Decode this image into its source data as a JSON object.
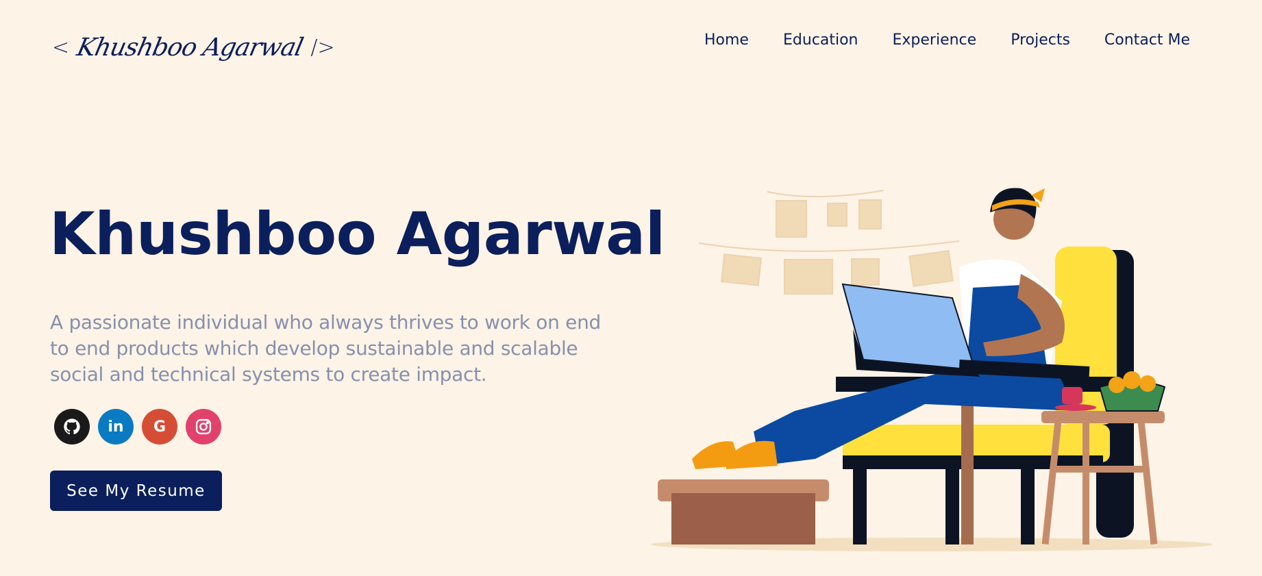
{
  "logo": {
    "open": "<",
    "signature": "Khushboo Agarwal",
    "close": "/>"
  },
  "nav": {
    "items": [
      "Home",
      "Education",
      "Experience",
      "Projects",
      "Contact Me"
    ]
  },
  "hero": {
    "title": "Khushboo Agarwal",
    "description": "A passionate individual who always thrives to work on end to end products which develop sustainable and scalable social and technical systems to create impact.",
    "resume_button": "See My Resume"
  },
  "socials": [
    {
      "icon": "github-icon",
      "color": "#1a1a1a"
    },
    {
      "icon": "linkedin-icon",
      "color": "#0a7bc2",
      "glyph": "in"
    },
    {
      "icon": "google-icon",
      "color": "#d64d35",
      "glyph": "G"
    },
    {
      "icon": "instagram-icon",
      "color": "#e2416b"
    }
  ],
  "colors": {
    "background": "#fdf3e6",
    "primary": "#0b1f5c",
    "muted_text": "#8690ae"
  }
}
